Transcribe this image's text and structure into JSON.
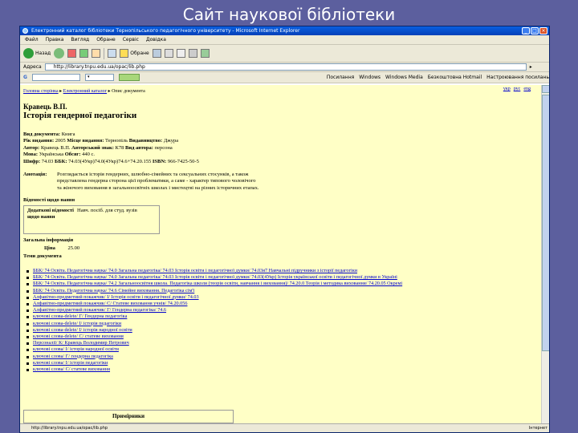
{
  "slide": {
    "title": "Сайт наукової бібліотеки"
  },
  "browser": {
    "title": "Електронний каталог бібліотеки Тернопільського педагогічного університету - Microsoft Internet Explorer",
    "window_buttons": [
      "_",
      "□",
      "×"
    ],
    "menu": [
      "Файл",
      "Правка",
      "Вигляд",
      "Обране",
      "Сервіс",
      "Довідка"
    ],
    "toolbar": {
      "back": "Назад",
      "favorites": "Обране"
    },
    "address_label": "Адреса",
    "address": "http://library.tnpu.edu.ua/opac/lib.php",
    "links_label": "Посилання",
    "links": [
      "Windows",
      "Windows Media",
      "Безкоштовна Hotmail",
      "Настроювання посилань"
    ],
    "status": "http://library.tnpu.edu.ua/opac/lib.php",
    "zone": "Інтернет"
  },
  "page": {
    "breadcrumb": [
      "Головна сторінка",
      "Електронний каталог",
      "Опис документа"
    ],
    "views": [
      "укр",
      "рус",
      "eng"
    ],
    "author": "Кравець В.П.",
    "book_title": "Історія гендерної педагогіки",
    "meta": [
      {
        "label": "Вид документа:",
        "value": "Книга"
      },
      {
        "label": "Рік видання:",
        "value": "2005"
      },
      {
        "label": "Місце видання:",
        "value": "Тернопіль"
      },
      {
        "label": "Видавництво:",
        "value": "Джура"
      },
      {
        "label": "Автор:",
        "value": "Кравець В.П."
      },
      {
        "label": "Авторський знак:",
        "value": "К78"
      },
      {
        "label": "Вид автора:",
        "value": "персона"
      },
      {
        "label": "Мова:",
        "value": "Українська"
      },
      {
        "label": "Обсяг:",
        "value": "440 с."
      },
      {
        "label": "Шифр:",
        "value": "74.03"
      },
      {
        "label": "ББК:",
        "value": "74.03(4Укр)74.0(4Укр)74.6+74.20.155"
      },
      {
        "label": "ISBN:",
        "value": "966-7425-50-5"
      }
    ],
    "annotation_label": "Анотація:",
    "annotation_lines": [
      "Розглядається історія гендерних, шлюбно-сімейних та сексуальних стосунків, а також",
      "представлена гендерна сторона цієї проблематики, а саме - характер типового чоловічого",
      "та жіночого виховання в загальноосвітніх школах і мистецтві на різних історичних етапах."
    ],
    "section_copies": "Відомості щодо наявн",
    "additional_label": "Додаткові відомості щодо наявн",
    "additional_value": "Навч. посіб. для студ. вузів",
    "section_general": "Загальна інформація",
    "price_label": "Ціна",
    "price_value": "25.00",
    "section_topics": "Теми документа",
    "topics": [
      "ББК/ 74 Освіта. Педагогічна наука/ 74.0 Загальна педагогіка/ 74.03 Історія освіти і педагогічної думки/ 74.03я7 Навчальні підручники з історії педагогіки",
      "ББК/ 74 Освіта. Педагогічна наука/ 74.0 Загальна педагогіка/ 74.03 Історія освіти і педагогічної думки/ 74.03(4Укр) Історія української освіти і педагогічної думки в Україні",
      "ББК/ 74 Освіта. Педагогічна наука/ 74.2 Загальноосвітня школа. Педагогіка школи (теорія освіти, навчання і виховання)/ 74.20.0 Теорія і методика виховання/ 74.20.05 Окремі",
      "ББК/ 74 Освіта. Педагогічна наука/ 74.6 Сімейне виховання. Педагогіка сім'ї",
      "Алфавітно-предметний покажчик/ І/ Історія освіти і педагогічної думки/ 74.03",
      "Алфавітно-предметний покажчик/ С/ Статеве виховання учнів/ 74.20.056",
      "Алфавітно-предметний покажчик/ Г/ Гендерна педагогіка/ 74.6",
      "ключові слова-delete/ Г/ Гендерна педагогіка",
      "ключові слова-delete/ І/ історія педагогіки",
      "ключові слова-delete/ І/ історія народної освіти",
      "ключові слова-delete/ С/ статеве виховання",
      "Персоналії/ К/ Кравець Володимир Петрович",
      "ключові слова/ І/ історія народної освіти",
      "ключові слова/ Г/ гендерна педагогіка",
      "ключові слова/ І/ історія педагогіки",
      "ключові слова/ С/ статеве виховання"
    ],
    "revisions_label": "Примірники"
  },
  "colors": {
    "slide_bg": "#5c5f9e",
    "page_bg": "#ffffc6",
    "link": "#0000cc"
  }
}
